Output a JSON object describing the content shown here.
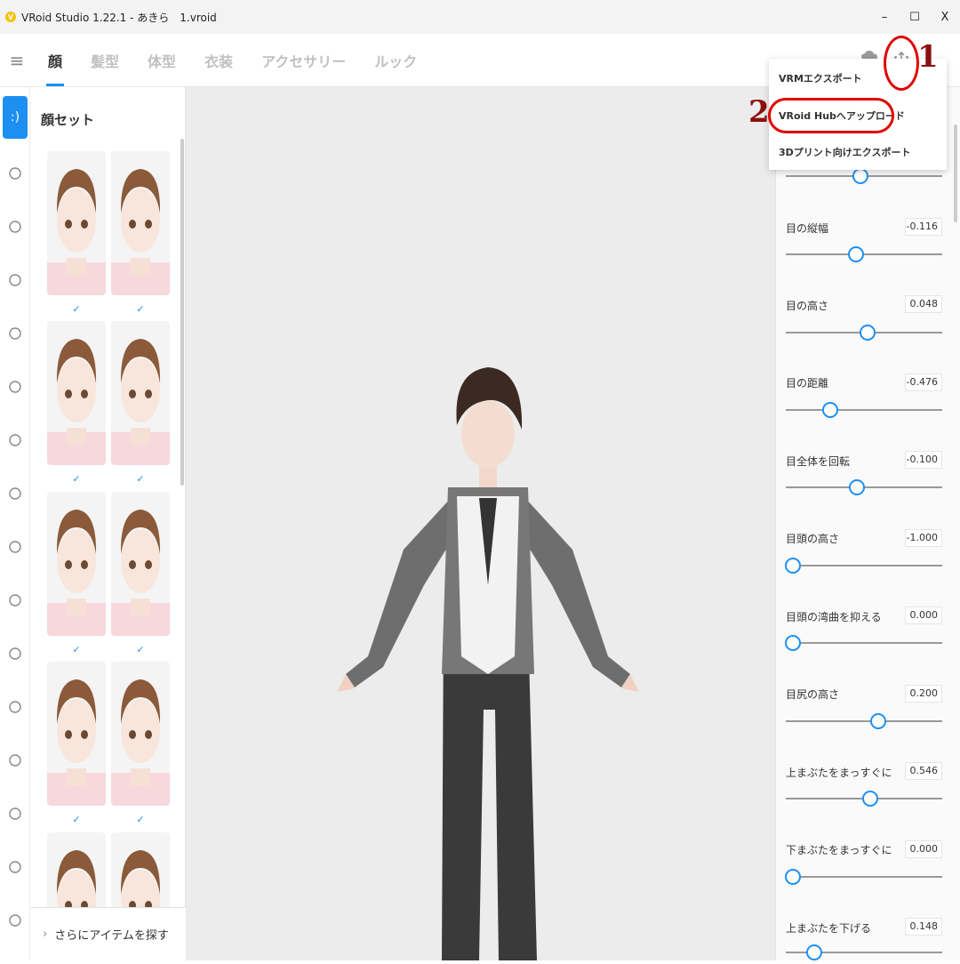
{
  "window": {
    "title": "VRoid Studio 1.22.1 - あきら　1.vroid",
    "controls": {
      "minimize": "–",
      "maximize": "☐",
      "close": "X"
    }
  },
  "nav": {
    "tabs": [
      {
        "label": "顔",
        "active": true
      },
      {
        "label": "髪型",
        "active": false
      },
      {
        "label": "体型",
        "active": false
      },
      {
        "label": "衣装",
        "active": false
      },
      {
        "label": "アクセサリー",
        "active": false
      },
      {
        "label": "ルック",
        "active": false
      }
    ]
  },
  "export_menu": {
    "items": [
      "VRMエクスポート",
      "VRoid Hubへアップロード",
      "3Dプリント向けエクスポート"
    ]
  },
  "faceset": {
    "title": "顔セット",
    "check": "✓",
    "more_label": "さらにアイテムを探す"
  },
  "sliders": [
    {
      "label": "",
      "value": "-0.050",
      "fraction": 0.475
    },
    {
      "label": "目の縦幅",
      "value": "-0.116",
      "fraction": 0.442
    },
    {
      "label": "目の高さ",
      "value": "0.048",
      "fraction": 0.524
    },
    {
      "label": "目の距離",
      "value": "-0.476",
      "fraction": 0.262
    },
    {
      "label": "目全体を回転",
      "value": "-0.100",
      "fraction": 0.45
    },
    {
      "label": "目頭の高さ",
      "value": "-1.000",
      "fraction": 0.0
    },
    {
      "label": "目頭の湾曲を抑える",
      "value": "0.000",
      "fraction": 0.0
    },
    {
      "label": "目尻の高さ",
      "value": "0.200",
      "fraction": 0.6
    },
    {
      "label": "上まぶたをまっすぐに",
      "value": "0.546",
      "fraction": 0.546
    },
    {
      "label": "下まぶたをまっすぐに",
      "value": "0.000",
      "fraction": 0.0
    },
    {
      "label": "上まぶたを下げる",
      "value": "0.148",
      "fraction": 0.148
    }
  ],
  "annotations": {
    "step1": "1",
    "step2": "2"
  },
  "colors": {
    "accent": "#1d8ff2",
    "annotation": "#e00000"
  }
}
